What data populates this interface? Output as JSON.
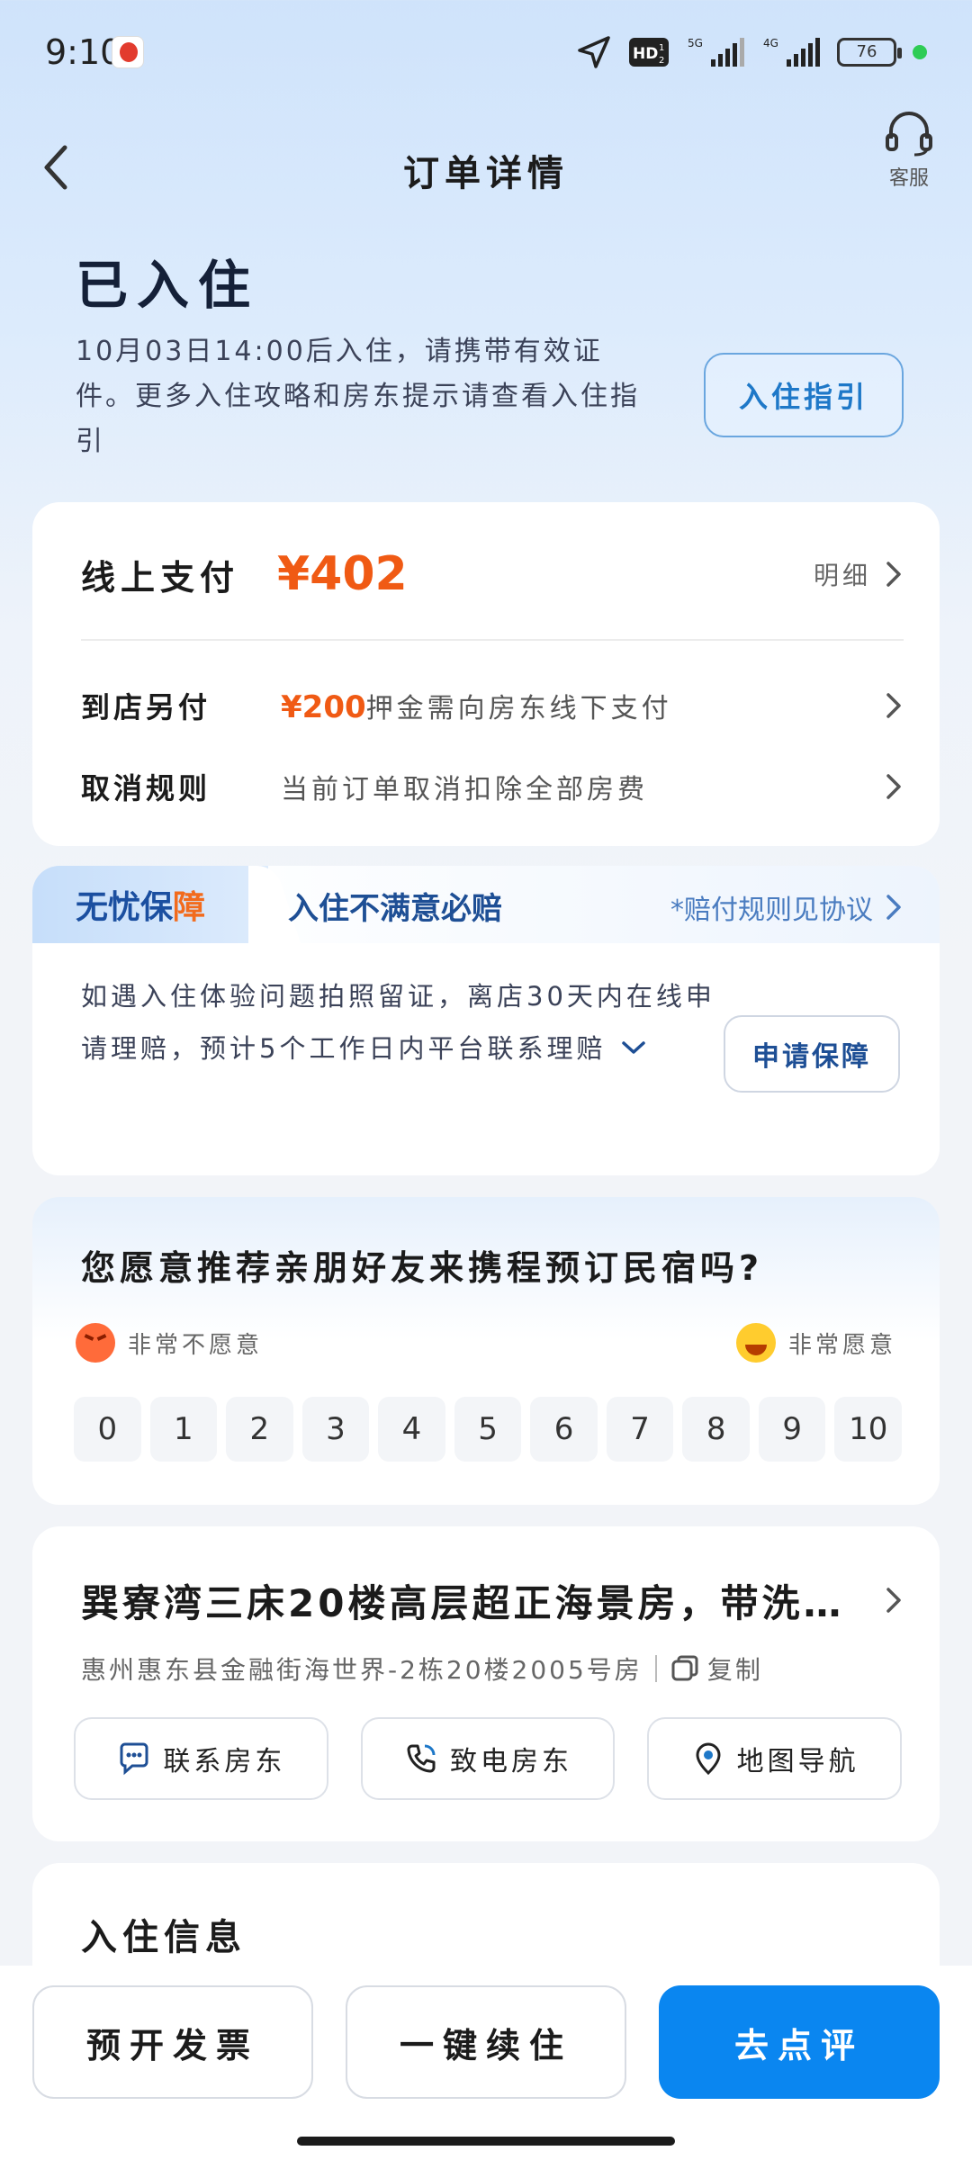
{
  "status_bar": {
    "time": "9:10",
    "battery": "76",
    "hd_label": "HD",
    "net_5g": "5G",
    "net_4g": "4G"
  },
  "nav": {
    "title": "订单详情",
    "service_label": "客服"
  },
  "booking_status": {
    "title": "已入住",
    "description": "10月03日14:00后入住，请携带有效证件。更多入住攻略和房东提示请查看入住指引",
    "guide_button": "入住指引"
  },
  "payment": {
    "online_label": "线上支付",
    "online_amount": "¥402",
    "detail_label": "明细",
    "store_label": "到店另付",
    "store_amount": "¥200",
    "store_note": "押金需向房东线下支付",
    "cancel_label": "取消规则",
    "cancel_note": "当前订单取消扣除全部房费"
  },
  "guarantee": {
    "tab_prefix": "无忧保",
    "tab_suffix": "障",
    "slogan": "入住不满意必赔",
    "rule_link": "*赔付规则见协议",
    "description": "如遇入住体验问题拍照留证，离店30天内在线申请理赔，预计5个工作日内平台联系理赔",
    "apply_button": "申请保障"
  },
  "nps": {
    "question": "您愿意推荐亲朋好友来携程预订民宿吗?",
    "low_label": "非常不愿意",
    "high_label": "非常愿意",
    "scale": [
      "0",
      "1",
      "2",
      "3",
      "4",
      "5",
      "6",
      "7",
      "8",
      "9",
      "10"
    ]
  },
  "property": {
    "title": "巽寮湾三床20楼高层超正海景房，带洗…",
    "address": "惠州惠东县金融街海世界-2栋20楼2005号房",
    "copy_label": "复制",
    "contact_label": "联系房东",
    "call_label": "致电房东",
    "map_label": "地图导航"
  },
  "checkin_info": {
    "title": "入住信息"
  },
  "bottom": {
    "invoice": "预开发票",
    "renew": "一键续住",
    "review": "去点评"
  },
  "colors": {
    "accent": "#0a86f0",
    "price": "#f05a14",
    "guarantee_blue": "#1b4fa0"
  }
}
